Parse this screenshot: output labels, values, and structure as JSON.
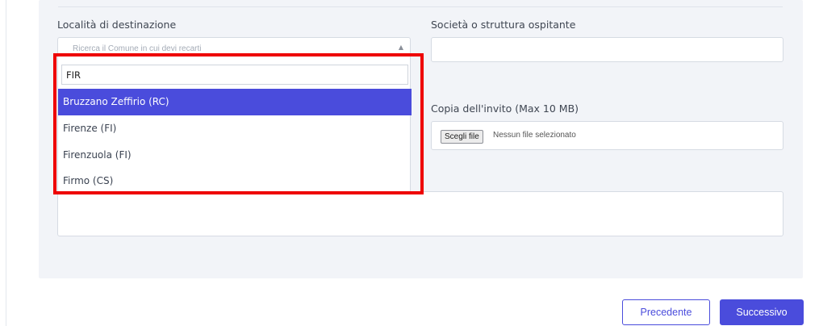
{
  "form": {
    "destination": {
      "label": "Località di destinazione",
      "placeholder": "Ricerca il Comune in cui devi recarti",
      "search_value": "FIR",
      "options": [
        "Bruzzano Zeffirio (RC)",
        "Firenze (FI)",
        "Firenzuola (FI)",
        "Firmo (CS)"
      ],
      "active_index": 0
    },
    "host": {
      "label": "Società o struttura ospitante",
      "value": ""
    },
    "invite": {
      "label": "Copia dell'invito (Max 10 MB)",
      "button_label": "Scegli file",
      "status_text": "Nessun file selezionato"
    },
    "notes": {
      "value": ""
    }
  },
  "nav": {
    "prev_label": "Precedente",
    "next_label": "Successivo"
  },
  "colors": {
    "accent": "#4a4cdc",
    "highlight": "#ee0000",
    "panel": "#f2f4f8"
  },
  "icons": {
    "caret": "caret-up-icon"
  }
}
